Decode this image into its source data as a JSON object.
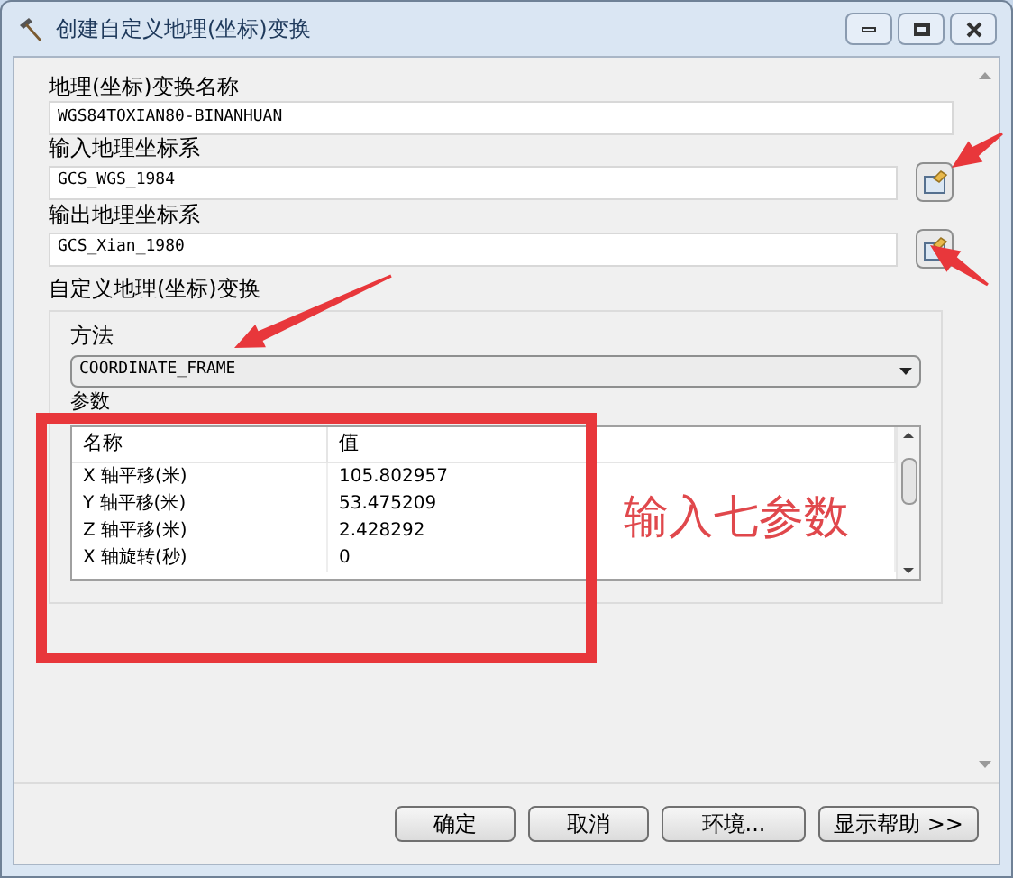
{
  "window": {
    "title": "创建自定义地理(坐标)变换"
  },
  "fields": [
    {
      "label": "地理(坐标)变换名称",
      "value": "WGS84TOXIAN80-BINANHUAN",
      "has_browse": false
    },
    {
      "label": "输入地理坐标系",
      "value": "GCS_WGS_1984",
      "has_browse": true
    },
    {
      "label": "输出地理坐标系",
      "value": "GCS_Xian_1980",
      "has_browse": true
    }
  ],
  "group": {
    "title": "自定义地理(坐标)变换",
    "method_label": "方法",
    "method_value": "COORDINATE_FRAME",
    "params_label": "参数",
    "table": {
      "columns": [
        "名称",
        "值"
      ],
      "rows": [
        [
          "X 轴平移(米)",
          "105.802957"
        ],
        [
          "Y 轴平移(米)",
          "53.475209"
        ],
        [
          "Z 轴平移(米)",
          "2.428292"
        ],
        [
          "X 轴旋转(秒)",
          "0"
        ]
      ]
    }
  },
  "annotation": {
    "text": "输入七参数"
  },
  "buttons": [
    "确定",
    "取消",
    "环境...",
    "显示帮助 >>"
  ]
}
